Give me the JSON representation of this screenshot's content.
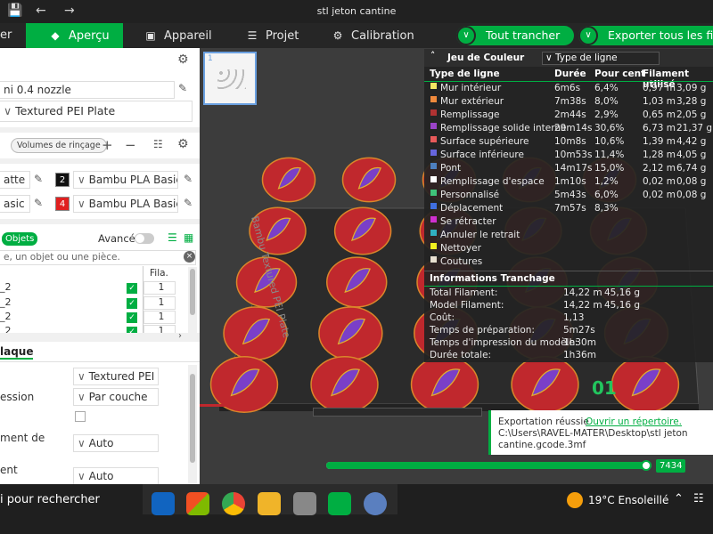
{
  "window": {
    "title": "stl jeton cantine"
  },
  "tabs": [
    {
      "label": "er",
      "active": false
    },
    {
      "label": "Aperçu",
      "active": true
    },
    {
      "label": "Appareil",
      "active": false
    },
    {
      "label": "Projet",
      "active": false
    },
    {
      "label": "Calibration",
      "active": false
    }
  ],
  "actions": {
    "slice": "Tout trancher",
    "export": "Exporter tous les fichi"
  },
  "sidebar": {
    "printer": "ni 0.4 nozzle",
    "plate": "Textured PEI Plate",
    "flush_button": "Volumes de rinçage",
    "filaments": [
      {
        "left": "atte",
        "num": "2",
        "color": "#111111",
        "name": "Bambu PLA Basic"
      },
      {
        "left": "asic",
        "num": "4",
        "color": "#e02020",
        "name": "Bambu PLA Basic"
      }
    ],
    "objects_tab": "Objets",
    "advanced_label": "Avancé",
    "search_placeholder": "e, un objet ou une pièce.",
    "fila_header": "Fila.",
    "objects": [
      {
        "name": "_2",
        "fila": "1"
      },
      {
        "name": "_2",
        "fila": "1"
      },
      {
        "name": "_2",
        "fila": "1"
      },
      {
        "name": "_2",
        "fila": "1"
      }
    ],
    "plate_section": "laque",
    "settings": [
      {
        "label": "",
        "value": "Textured PEI ..."
      },
      {
        "label": "ession",
        "value": "Par couche"
      },
      {
        "label": "",
        "value": ""
      },
      {
        "label": "ment de",
        "value": "Auto"
      },
      {
        "label": "ent",
        "value": "Auto"
      }
    ]
  },
  "plate_label": "Bambu Textured PEI Plate",
  "plate_number": "01",
  "stats": {
    "dropdown_title": "Jeu de Couleur",
    "dropdown_value": "Type de ligne",
    "headers": [
      "Type de ligne",
      "Durée",
      "Pour cent",
      "Filament utilisé"
    ],
    "rows": [
      {
        "name": "Mur intérieur",
        "color": "#f5e663",
        "time": "6m6s",
        "pct": "6,4%",
        "m": "0,97 m",
        "g": "3,09 g"
      },
      {
        "name": "Mur extérieur",
        "color": "#f08a3c",
        "time": "7m38s",
        "pct": "8,0%",
        "m": "1,03 m",
        "g": "3,28 g"
      },
      {
        "name": "Remplissage",
        "color": "#b03232",
        "time": "2m44s",
        "pct": "2,9%",
        "m": "0,65 m",
        "g": "2,05 g"
      },
      {
        "name": "Remplissage solide interne",
        "color": "#9b44c9",
        "time": "29m14s",
        "pct": "30,6%",
        "m": "6,73 m",
        "g": "21,37 g"
      },
      {
        "name": "Surface supérieure",
        "color": "#e85a5a",
        "time": "10m8s",
        "pct": "10,6%",
        "m": "1,39 m",
        "g": "4,42 g"
      },
      {
        "name": "Surface inférieure",
        "color": "#6666dd",
        "time": "10m53s",
        "pct": "11,4%",
        "m": "1,28 m",
        "g": "4,05 g"
      },
      {
        "name": "Pont",
        "color": "#4d7fbf",
        "time": "14m17s",
        "pct": "15,0%",
        "m": "2,12 m",
        "g": "6,74 g"
      },
      {
        "name": "Remplissage d'espace",
        "color": "#ffffff",
        "time": "1m10s",
        "pct": "1,2%",
        "m": "0,02 m",
        "g": "0,08 g"
      },
      {
        "name": "Personnalisé",
        "color": "#3fc47a",
        "time": "5m43s",
        "pct": "6,0%",
        "m": "0,02 m",
        "g": "0,08 g"
      },
      {
        "name": "Déplacement",
        "color": "#3f6fe0",
        "time": "7m57s",
        "pct": "8,3%",
        "m": "",
        "g": ""
      },
      {
        "name": "Se rétracter",
        "color": "#d030d0",
        "time": "",
        "pct": "",
        "m": "",
        "g": ""
      },
      {
        "name": "Annuler le retrait",
        "color": "#30b0c0",
        "time": "",
        "pct": "",
        "m": "",
        "g": ""
      },
      {
        "name": "Nettoyer",
        "color": "#f0f020",
        "time": "",
        "pct": "",
        "m": "",
        "g": ""
      },
      {
        "name": "Coutures",
        "color": "#e8e0d0",
        "time": "",
        "pct": "",
        "m": "",
        "g": ""
      }
    ],
    "info_title": "Informations Tranchage",
    "info": [
      {
        "label": "Total Filament:",
        "v1": "14,22 m",
        "v2": "45,16 g"
      },
      {
        "label": "Model Filament:",
        "v1": "14,22 m",
        "v2": "45,16 g"
      },
      {
        "label": "Coût:",
        "v1": "1,13",
        "v2": ""
      },
      {
        "label": "Temps de préparation:",
        "v1": "5m27s",
        "v2": ""
      },
      {
        "label": "Temps d'impression du modèle:",
        "v1": "1h30m",
        "v2": ""
      },
      {
        "label": "Durée totale:",
        "v1": "1h36m",
        "v2": ""
      }
    ]
  },
  "notification": {
    "title": "Exportation réussie",
    "link": "Ouvrir un répertoire.",
    "path": "C:\\Users\\RAVEL-MATER\\Desktop\\stl jeton cantine.gcode.3mf"
  },
  "layer_value": "7434",
  "layer_progress": 1.0,
  "taskbar": {
    "search": "i pour rechercher",
    "weather": "19°C Ensoleillé"
  },
  "colors": {
    "accent": "#00ae42",
    "plate": "#2b2b2b",
    "token_red": "#c0282d",
    "token_purple": "#7a3fc8"
  }
}
